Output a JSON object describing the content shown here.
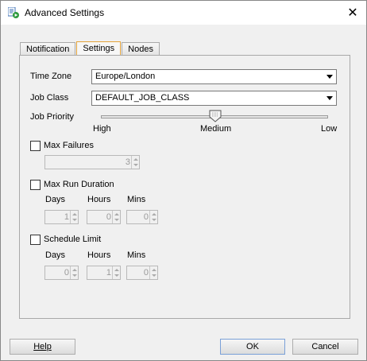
{
  "window": {
    "title": "Advanced Settings",
    "close_glyph": "✕"
  },
  "tabs": [
    {
      "label": "Notification",
      "active": false
    },
    {
      "label": "Settings",
      "active": true
    },
    {
      "label": "Nodes",
      "active": false
    }
  ],
  "settings": {
    "time_zone_label": "Time Zone",
    "time_zone_value": "Europe/London",
    "job_class_label": "Job Class",
    "job_class_value": "DEFAULT_JOB_CLASS",
    "job_priority_label": "Job Priority",
    "priority_high": "High",
    "priority_medium": "Medium",
    "priority_low": "Low",
    "priority_level": 0.5,
    "max_failures_label": "Max Failures",
    "max_failures_checked": false,
    "max_failures_value": "3",
    "max_run_duration_label": "Max Run Duration",
    "max_run_duration_checked": false,
    "duration_days_label": "Days",
    "duration_hours_label": "Hours",
    "duration_mins_label": "Mins",
    "duration_days_value": "1",
    "duration_hours_value": "0",
    "duration_mins_value": "0",
    "schedule_limit_label": "Schedule Limit",
    "schedule_limit_checked": false,
    "limit_days_label": "Days",
    "limit_hours_label": "Hours",
    "limit_mins_label": "Mins",
    "limit_days_value": "0",
    "limit_hours_value": "1",
    "limit_mins_value": "0"
  },
  "buttons": {
    "help": "Help",
    "ok": "OK",
    "cancel": "Cancel"
  },
  "icons": {
    "app": "schedule-settings-icon",
    "close": "close-icon"
  },
  "colors": {
    "active_tab_border": "#e5a43a",
    "default_button_border": "#7aa0d8"
  }
}
